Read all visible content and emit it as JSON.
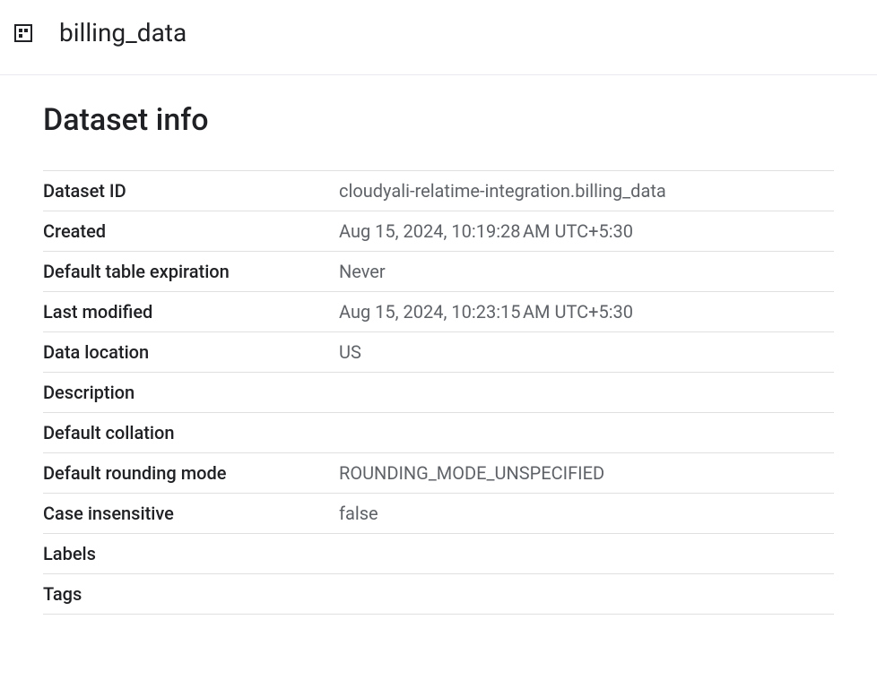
{
  "header": {
    "title": "billing_data"
  },
  "section": {
    "title": "Dataset info"
  },
  "rows": [
    {
      "label": "Dataset ID",
      "value": "cloudyali-relatime-integration.billing_data"
    },
    {
      "label": "Created",
      "value": "Aug 15, 2024, 10:19:28 AM UTC+5:30"
    },
    {
      "label": "Default table expiration",
      "value": "Never"
    },
    {
      "label": "Last modified",
      "value": "Aug 15, 2024, 10:23:15 AM UTC+5:30"
    },
    {
      "label": "Data location",
      "value": "US"
    },
    {
      "label": "Description",
      "value": ""
    },
    {
      "label": "Default collation",
      "value": ""
    },
    {
      "label": "Default rounding mode",
      "value": "ROUNDING_MODE_UNSPECIFIED"
    },
    {
      "label": "Case insensitive",
      "value": "false"
    },
    {
      "label": "Labels",
      "value": ""
    },
    {
      "label": "Tags",
      "value": ""
    }
  ]
}
